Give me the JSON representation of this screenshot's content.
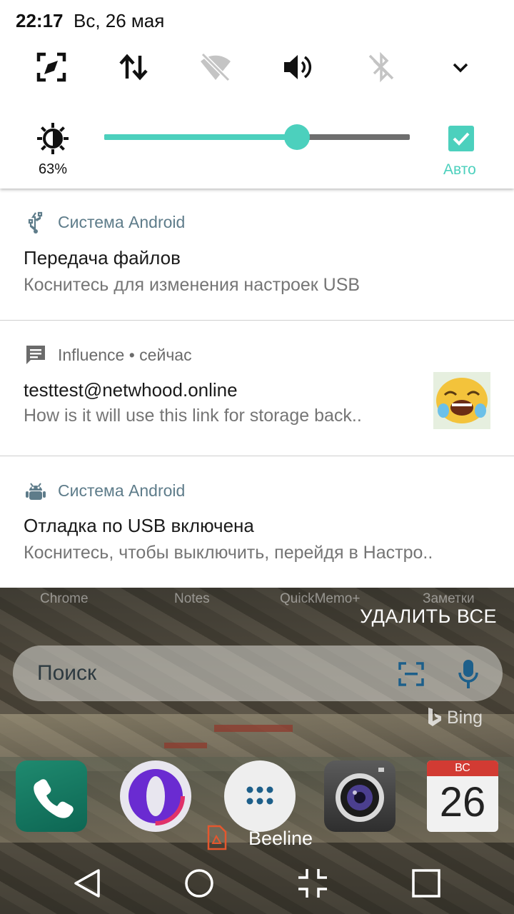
{
  "status_bar": {
    "time": "22:17",
    "date": "Вс, 26 мая"
  },
  "quick_settings": {
    "tiles": [
      {
        "name": "screen-rotation",
        "icon": "rotate-screen-icon",
        "active": true
      },
      {
        "name": "mobile-data",
        "icon": "data-transfer-arrows-icon",
        "active": true
      },
      {
        "name": "wifi",
        "icon": "wifi-off-icon",
        "active": false
      },
      {
        "name": "sound",
        "icon": "volume-icon",
        "active": true
      },
      {
        "name": "bluetooth",
        "icon": "bluetooth-off-icon",
        "active": false
      }
    ],
    "expand_icon": "chevron-down-icon",
    "brightness": {
      "percent_label": "63%",
      "level": 0.63,
      "auto_label": "Авто",
      "auto_checked": true
    },
    "accent_color": "#4cd0bd"
  },
  "notifications": [
    {
      "icon": "usb-icon",
      "app": "Система Android",
      "title": "Передача файлов",
      "text": "Коснитесь для изменения настроек USB"
    },
    {
      "icon": "message-icon",
      "app": "Influence • сейчас",
      "title": "testtest@netwhood.online",
      "text": "How is it will use this link for storage back..",
      "thumbnail": "laughing-emoji-icon"
    },
    {
      "icon": "android-debug-icon",
      "app": "Система Android",
      "title": "Отладка по USB включена",
      "text": "Коснитесь, чтобы выключить, перейдя в Настро.."
    }
  ],
  "clear_all_label": "УДАЛИТЬ ВСЕ",
  "home": {
    "dock_labels": [
      "Chrome",
      "Notes",
      "QuickMemo+",
      "Заметки"
    ],
    "search_placeholder": "Поиск",
    "bing_label": "Bing",
    "apps": [
      "phone-icon",
      "opera-icon",
      "app-drawer-icon",
      "camera-icon",
      "calendar-icon"
    ],
    "calendar": {
      "weekday": "ВС",
      "day": "26"
    },
    "carrier": "Beeline"
  },
  "nav_bar": [
    "back-icon",
    "home-icon",
    "split-screen-icon",
    "recents-icon"
  ]
}
